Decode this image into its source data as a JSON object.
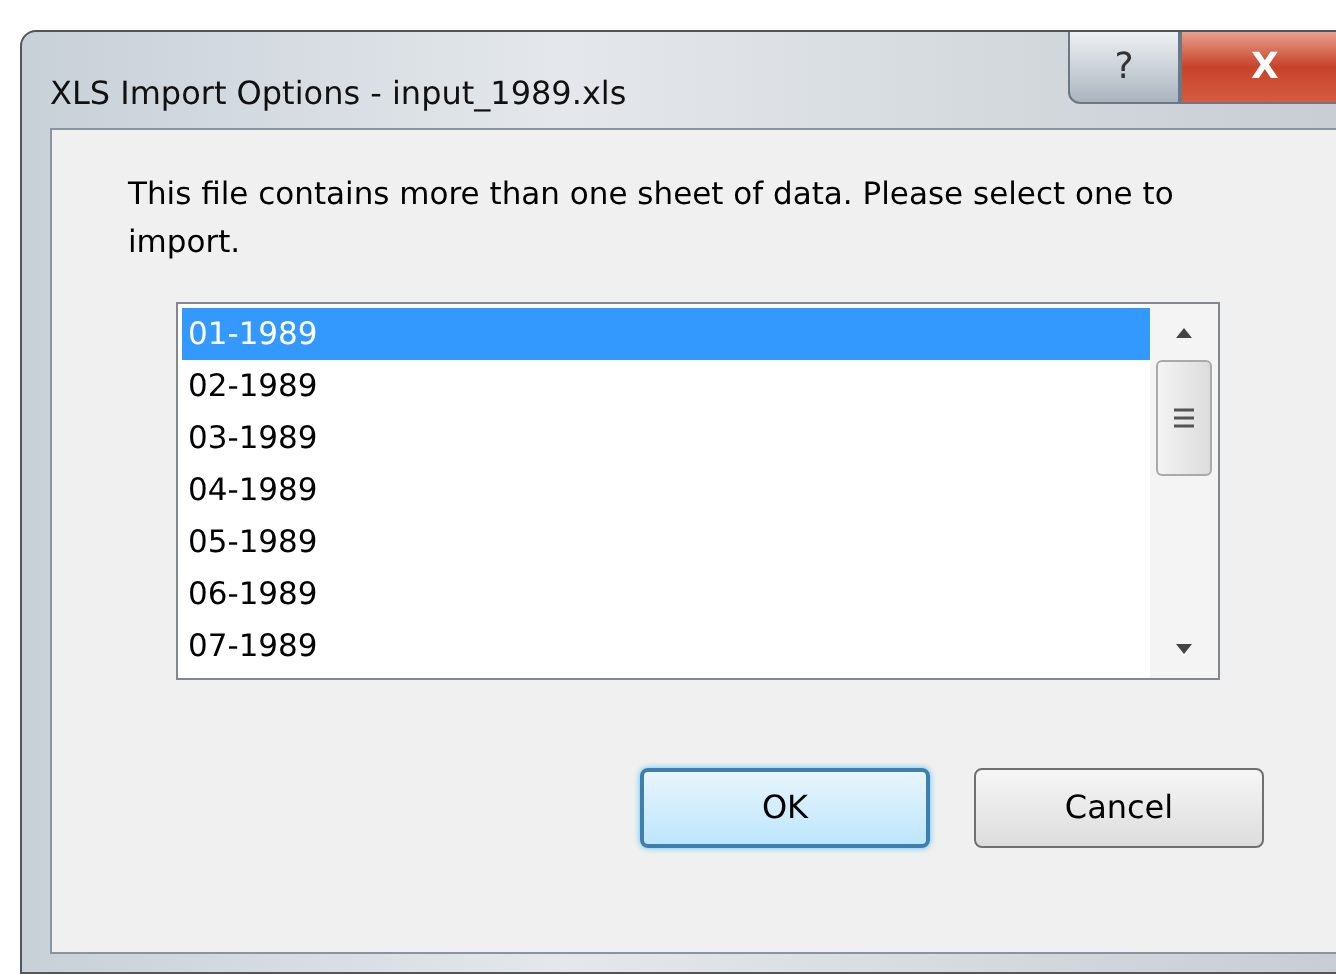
{
  "window": {
    "title": "XLS Import Options - input_1989.xls",
    "help_button": "?",
    "close_button": "X"
  },
  "message": "This file contains more than one sheet of data.  Please select one to import.",
  "sheets": [
    {
      "label": "01-1989",
      "selected": true
    },
    {
      "label": "02-1989",
      "selected": false
    },
    {
      "label": "03-1989",
      "selected": false
    },
    {
      "label": "04-1989",
      "selected": false
    },
    {
      "label": "05-1989",
      "selected": false
    },
    {
      "label": "06-1989",
      "selected": false
    },
    {
      "label": "07-1989",
      "selected": false
    }
  ],
  "buttons": [
    {
      "label": "OK",
      "default": true
    },
    {
      "label": "Cancel",
      "default": false
    }
  ]
}
